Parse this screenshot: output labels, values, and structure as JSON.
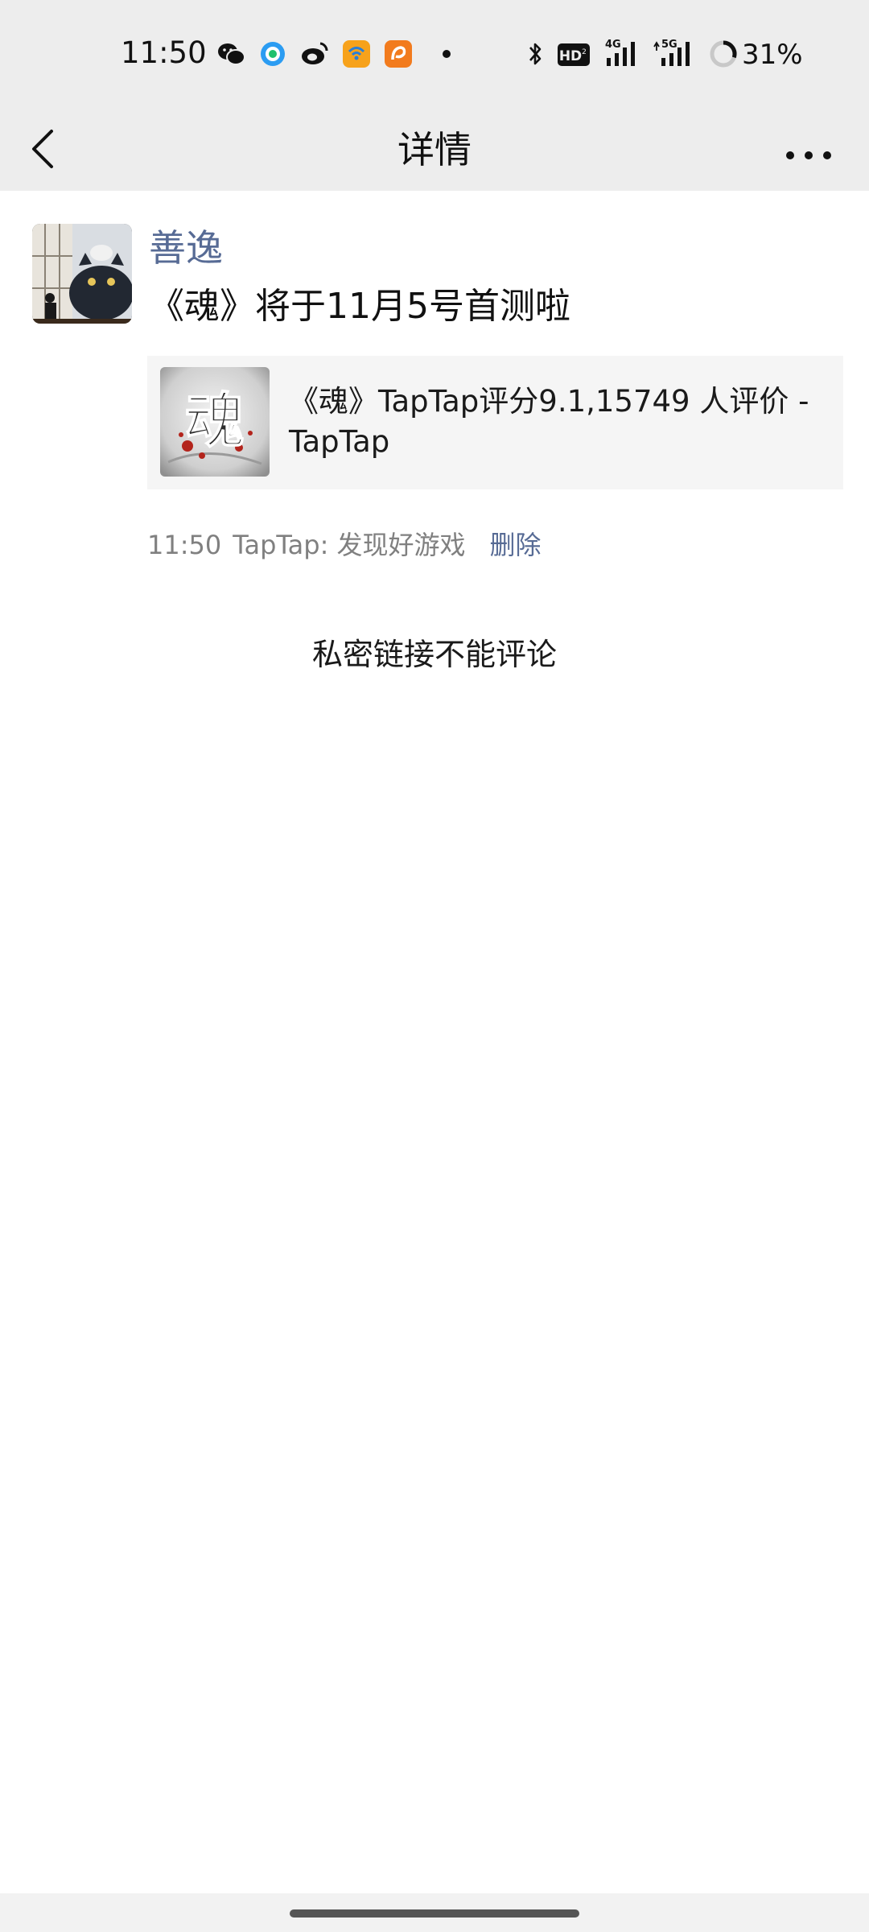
{
  "status_bar": {
    "time": "11:50",
    "icons": [
      "wechat-icon",
      "qq-browser-icon",
      "weibo-icon",
      "wifi-app-icon",
      "uc-browser-icon",
      "notification-dot",
      "bluetooth-icon",
      "hd-icon",
      "signal-4g-icon",
      "signal-5g-icon",
      "battery-ring-icon"
    ],
    "hd_label": "HD",
    "network_4g": "4G",
    "network_5g": "5G",
    "battery": "31%"
  },
  "header": {
    "back_icon": "chevron-left-icon",
    "title": "详情",
    "more_icon": "more-dots-icon"
  },
  "post": {
    "author": "善逸",
    "text": "《魂》将于11月5号首测啦",
    "link_card": {
      "title": "《魂》TapTap评分9.1,15749 人评价 - TapTap",
      "thumb_glyph": "魂"
    },
    "time": "11:50",
    "source": "TapTap: 发现好游戏",
    "delete_label": "删除"
  },
  "private_note": "私密链接不能评论",
  "colors": {
    "bar_bg": "#ededed",
    "link_blue": "#576b95",
    "card_bg": "#f5f5f5",
    "meta_gray": "#808080"
  }
}
